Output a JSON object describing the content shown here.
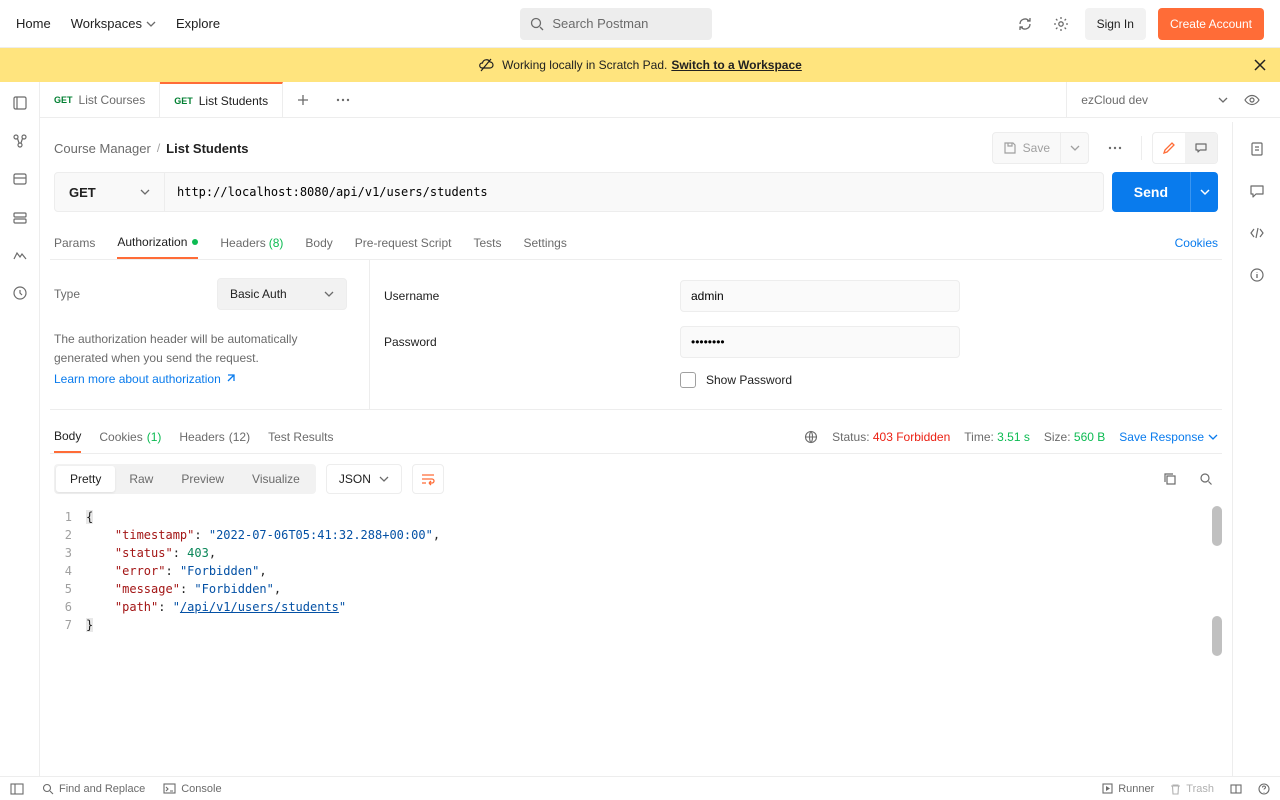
{
  "topnav": {
    "home": "Home",
    "workspaces": "Workspaces",
    "explore": "Explore",
    "search_placeholder": "Search Postman",
    "signin": "Sign In",
    "create": "Create Account"
  },
  "banner": {
    "prefix": "Working locally in Scratch Pad.",
    "link": "Switch to a Workspace"
  },
  "tabs": {
    "items": [
      {
        "method": "GET",
        "label": "List Courses"
      },
      {
        "method": "GET",
        "label": "List Students"
      }
    ],
    "env": "ezCloud dev"
  },
  "breadcrumb": {
    "root": "Course Manager",
    "current": "List Students",
    "save": "Save"
  },
  "request": {
    "method": "GET",
    "url": "http://localhost:8080/api/v1/users/students",
    "send": "Send"
  },
  "section_tabs": {
    "params": "Params",
    "auth": "Authorization",
    "headers": "Headers",
    "headers_count": "(8)",
    "body": "Body",
    "prereq": "Pre-request Script",
    "tests": "Tests",
    "settings": "Settings",
    "cookies": "Cookies"
  },
  "auth": {
    "type_label": "Type",
    "type_value": "Basic Auth",
    "desc": "The authorization header will be automatically generated when you send the request.",
    "learn": "Learn more about authorization",
    "username_label": "Username",
    "username_value": "admin",
    "password_label": "Password",
    "password_value": "••••••••",
    "showpw": "Show Password"
  },
  "resp_tabs": {
    "body": "Body",
    "cookies": "Cookies",
    "cookies_count": "(1)",
    "headers": "Headers",
    "headers_count": "(12)",
    "tests": "Test Results",
    "status_label": "Status:",
    "status_value": "403 Forbidden",
    "time_label": "Time:",
    "time_value": "3.51 s",
    "size_label": "Size:",
    "size_value": "560 B",
    "save": "Save Response"
  },
  "body_view": {
    "pretty": "Pretty",
    "raw": "Raw",
    "preview": "Preview",
    "visualize": "Visualize",
    "format": "JSON"
  },
  "response_json": {
    "lines": [
      {
        "n": "1",
        "tokens": [
          {
            "t": "brace",
            "v": "{"
          }
        ]
      },
      {
        "n": "2",
        "tokens": [
          {
            "t": "indent",
            "v": "    "
          },
          {
            "t": "key",
            "v": "\"timestamp\""
          },
          {
            "t": "punc",
            "v": ": "
          },
          {
            "t": "str",
            "v": "\"2022-07-06T05:41:32.288+00:00\""
          },
          {
            "t": "punc",
            "v": ","
          }
        ]
      },
      {
        "n": "3",
        "tokens": [
          {
            "t": "indent",
            "v": "    "
          },
          {
            "t": "key",
            "v": "\"status\""
          },
          {
            "t": "punc",
            "v": ": "
          },
          {
            "t": "num",
            "v": "403"
          },
          {
            "t": "punc",
            "v": ","
          }
        ]
      },
      {
        "n": "4",
        "tokens": [
          {
            "t": "indent",
            "v": "    "
          },
          {
            "t": "key",
            "v": "\"error\""
          },
          {
            "t": "punc",
            "v": ": "
          },
          {
            "t": "str",
            "v": "\"Forbidden\""
          },
          {
            "t": "punc",
            "v": ","
          }
        ]
      },
      {
        "n": "5",
        "tokens": [
          {
            "t": "indent",
            "v": "    "
          },
          {
            "t": "key",
            "v": "\"message\""
          },
          {
            "t": "punc",
            "v": ": "
          },
          {
            "t": "str",
            "v": "\"Forbidden\""
          },
          {
            "t": "punc",
            "v": ","
          }
        ]
      },
      {
        "n": "6",
        "tokens": [
          {
            "t": "indent",
            "v": "    "
          },
          {
            "t": "key",
            "v": "\"path\""
          },
          {
            "t": "punc",
            "v": ": "
          },
          {
            "t": "str-q",
            "v": "\""
          },
          {
            "t": "str-link",
            "v": "/api/v1/users/students"
          },
          {
            "t": "str-q",
            "v": "\""
          }
        ]
      },
      {
        "n": "7",
        "tokens": [
          {
            "t": "brace",
            "v": "}"
          }
        ]
      }
    ]
  },
  "statusbar": {
    "find": "Find and Replace",
    "console": "Console",
    "runner": "Runner",
    "trash": "Trash"
  }
}
